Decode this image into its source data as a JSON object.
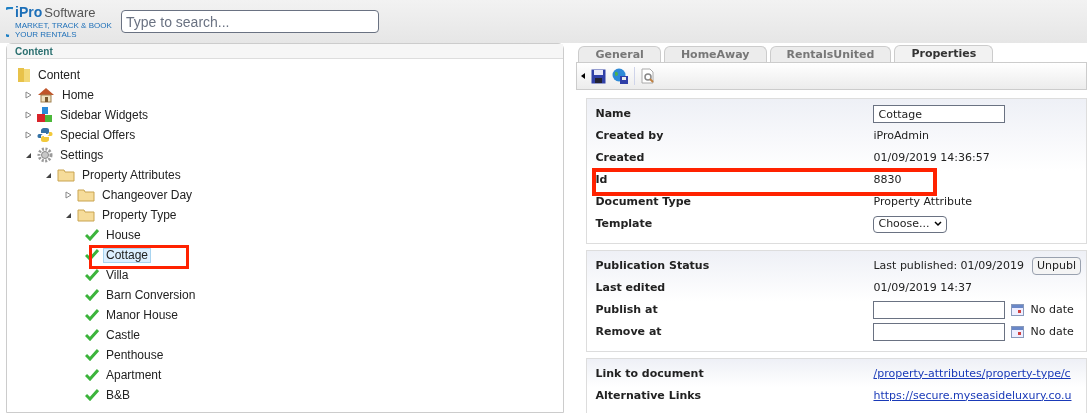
{
  "header": {
    "logo_main": "iPro",
    "logo_rest": "Software",
    "logo_tagline": "MARKET, TRACK & BOOK YOUR RENTALS",
    "search": {
      "placeholder": "Type to search..."
    }
  },
  "tree_panel": {
    "title": "Content",
    "tree": [
      {
        "label": "Content",
        "kind": "root",
        "selected": false,
        "children": [
          {
            "label": "Home",
            "kind": "home",
            "expanded": false,
            "selected": false
          },
          {
            "label": "Sidebar Widgets",
            "kind": "widgets",
            "expanded": false,
            "selected": false
          },
          {
            "label": "Special Offers",
            "kind": "offers",
            "expanded": false,
            "selected": false
          },
          {
            "label": "Settings",
            "kind": "settings",
            "expanded": true,
            "selected": false,
            "children": [
              {
                "label": "Property Attributes",
                "kind": "folder",
                "expanded": true,
                "selected": false,
                "children": [
                  {
                    "label": "Changeover Day",
                    "kind": "folder",
                    "expanded": false,
                    "selected": false
                  },
                  {
                    "label": "Property Type",
                    "kind": "folder",
                    "expanded": true,
                    "selected": false,
                    "children": [
                      {
                        "label": "House",
                        "kind": "published",
                        "selected": false
                      },
                      {
                        "label": "Cottage",
                        "kind": "published",
                        "selected": true
                      },
                      {
                        "label": "Villa",
                        "kind": "published",
                        "selected": false
                      },
                      {
                        "label": "Barn Conversion",
                        "kind": "published",
                        "selected": false
                      },
                      {
                        "label": "Manor House",
                        "kind": "published",
                        "selected": false
                      },
                      {
                        "label": "Castle",
                        "kind": "published",
                        "selected": false
                      },
                      {
                        "label": "Penthouse",
                        "kind": "published",
                        "selected": false
                      },
                      {
                        "label": "Apartment",
                        "kind": "published",
                        "selected": false
                      },
                      {
                        "label": "B&B",
                        "kind": "published",
                        "selected": false
                      }
                    ]
                  }
                ]
              }
            ]
          }
        ]
      }
    ]
  },
  "tabs": [
    {
      "label": "General",
      "selected": false
    },
    {
      "label": "HomeAway",
      "selected": false
    },
    {
      "label": "RentalsUnited",
      "selected": false
    },
    {
      "label": "Properties",
      "selected": true
    }
  ],
  "sections": [
    {
      "rows": [
        {
          "label": "Name",
          "kind": "input",
          "value": "Cottage"
        },
        {
          "label": "Created by",
          "kind": "text",
          "value": "iProAdmin"
        },
        {
          "label": "Created",
          "kind": "text",
          "value": "01/09/2019 14:36:57"
        },
        {
          "label": "Id",
          "kind": "text",
          "value": "8830"
        },
        {
          "label": "Document Type",
          "kind": "text",
          "value": "Property Attribute"
        },
        {
          "label": "Template",
          "kind": "select",
          "value": "Choose..."
        }
      ]
    },
    {
      "rows": [
        {
          "label": "Publication Status",
          "kind": "status",
          "value": "Last published: 01/09/2019",
          "button": "Unpubl"
        },
        {
          "label": "Last edited",
          "kind": "text",
          "value": "01/09/2019 14:37"
        },
        {
          "label": "Publish at",
          "kind": "date",
          "value": "No date"
        },
        {
          "label": "Remove at",
          "kind": "date",
          "value": "No date"
        }
      ]
    },
    {
      "rows": [
        {
          "label": "Link to document",
          "kind": "link",
          "value": "/property-attributes/property-type/c"
        },
        {
          "label": "Alternative Links",
          "kind": "link",
          "value": "https://secure.myseasideluxury.co.u"
        }
      ]
    }
  ]
}
